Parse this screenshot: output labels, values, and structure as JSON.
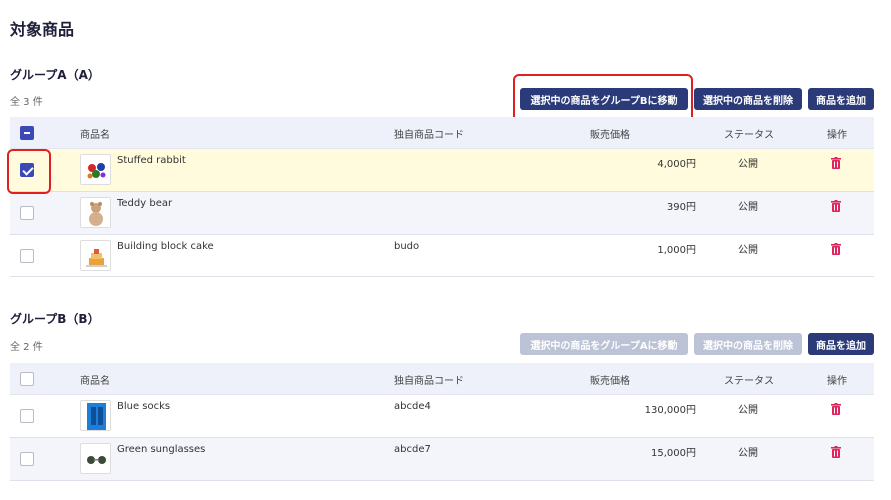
{
  "page_title": "対象商品",
  "columns": {
    "name": "商品名",
    "code": "独自商品コード",
    "price": "販売価格",
    "status": "ステータス",
    "action": "操作"
  },
  "groupA": {
    "title": "グループA（A）",
    "count": "全 3 件",
    "move_button": "選択中の商品をグループBに移動",
    "delete_button": "選択中の商品を削除",
    "add_button": "商品を追加",
    "header_checkbox": "indeterminate",
    "rows": [
      {
        "name": "Stuffed rabbit",
        "code": "",
        "price": "4,000円",
        "status": "公開",
        "checked": true
      },
      {
        "name": "Teddy bear",
        "code": "",
        "price": "390円",
        "status": "公開",
        "checked": false
      },
      {
        "name": "Building block cake",
        "code": "budo",
        "price": "1,000円",
        "status": "公開",
        "checked": false
      }
    ]
  },
  "groupB": {
    "title": "グループB（B）",
    "count": "全 2 件",
    "move_button": "選択中の商品をグループAに移動",
    "delete_button": "選択中の商品を削除",
    "add_button": "商品を追加",
    "header_checkbox": "unchecked",
    "rows": [
      {
        "name": "Blue socks",
        "code": "abcde4",
        "price": "130,000円",
        "status": "公開",
        "checked": false
      },
      {
        "name": "Green sunglasses",
        "code": "abcde7",
        "price": "15,000円",
        "status": "公開",
        "checked": false
      }
    ]
  },
  "colors": {
    "primary": "#2b3a78",
    "disabled": "#bcc3d6",
    "trash": "#e0245e",
    "highlight": "#e02020",
    "selected_row": "#fffbdc"
  }
}
